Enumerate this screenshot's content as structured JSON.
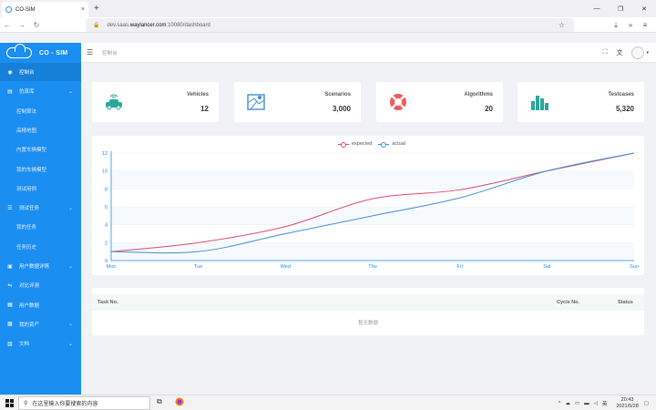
{
  "browser": {
    "tab_title": "CO-SIM",
    "tab_close": "×",
    "new_tab": "+",
    "url_prefix": "dev.saas.",
    "url_host": "waylancer.com",
    "url_suffix": ":10080/dashboard"
  },
  "sidebar": {
    "title": "CO - SIM",
    "items": [
      {
        "label": "控制台",
        "icon": "dashboard-icon",
        "active": true
      },
      {
        "label": "仿真库",
        "icon": "library-icon",
        "expandable": true
      },
      {
        "label": "控制算法",
        "sub": true
      },
      {
        "label": "高精地图",
        "sub": true
      },
      {
        "label": "内置车辆模型",
        "sub": true
      },
      {
        "label": "我的车辆模型",
        "sub": true
      },
      {
        "label": "测试用例",
        "sub": true
      },
      {
        "label": "测试任务",
        "icon": "list-icon",
        "expandable": true
      },
      {
        "label": "我的任务",
        "sub": true
      },
      {
        "label": "任务历史",
        "sub": true
      },
      {
        "label": "用户数据详情",
        "icon": "folder-icon",
        "expandable": true
      },
      {
        "label": "对比评测",
        "icon": "compare-icon"
      },
      {
        "label": "用户数据",
        "icon": "table-icon"
      },
      {
        "label": "我的资产",
        "icon": "grid-icon",
        "expandable": true
      },
      {
        "label": "文档",
        "icon": "doc-icon",
        "expandable": true
      }
    ]
  },
  "topbar": {
    "breadcrumb": "控制台"
  },
  "cards": [
    {
      "label": "Vehicles",
      "value": "12",
      "icon": "vehicle-icon",
      "color": "#2aa89a"
    },
    {
      "label": "Scenarios",
      "value": "3,000",
      "icon": "map-icon",
      "color": "#3f8fd8"
    },
    {
      "label": "Algorithms",
      "value": "20",
      "icon": "lifebuoy-icon",
      "color": "#ef5b5b"
    },
    {
      "label": "Testcases",
      "value": "5,320",
      "icon": "bar-chart-icon",
      "color": "#2aa89a"
    }
  ],
  "chart_data": {
    "type": "line",
    "categories": [
      "Mon",
      "Tue",
      "Wed",
      "Thu",
      "Fri",
      "Sat",
      "Sun"
    ],
    "series": [
      {
        "name": "expected",
        "color": "#e04a6a",
        "values": [
          1,
          2,
          3.8,
          6.9,
          7.9,
          10,
          12
        ]
      },
      {
        "name": "actual",
        "color": "#3f8fd8",
        "values": [
          1,
          1,
          3,
          5,
          7,
          10,
          12
        ]
      }
    ],
    "yticks": [
      0,
      2,
      4,
      6,
      8,
      10,
      12
    ],
    "ylim": [
      0,
      12
    ],
    "legend": "top-center",
    "grid": true
  },
  "table": {
    "columns": [
      "Task No.",
      "Cycle No.",
      "Status"
    ],
    "empty_text": "暂无数据"
  },
  "taskbar": {
    "search_placeholder": "在这里输入你要搜索的内容",
    "time": "20:43",
    "date": "2021/5/28",
    "ime": "英"
  }
}
